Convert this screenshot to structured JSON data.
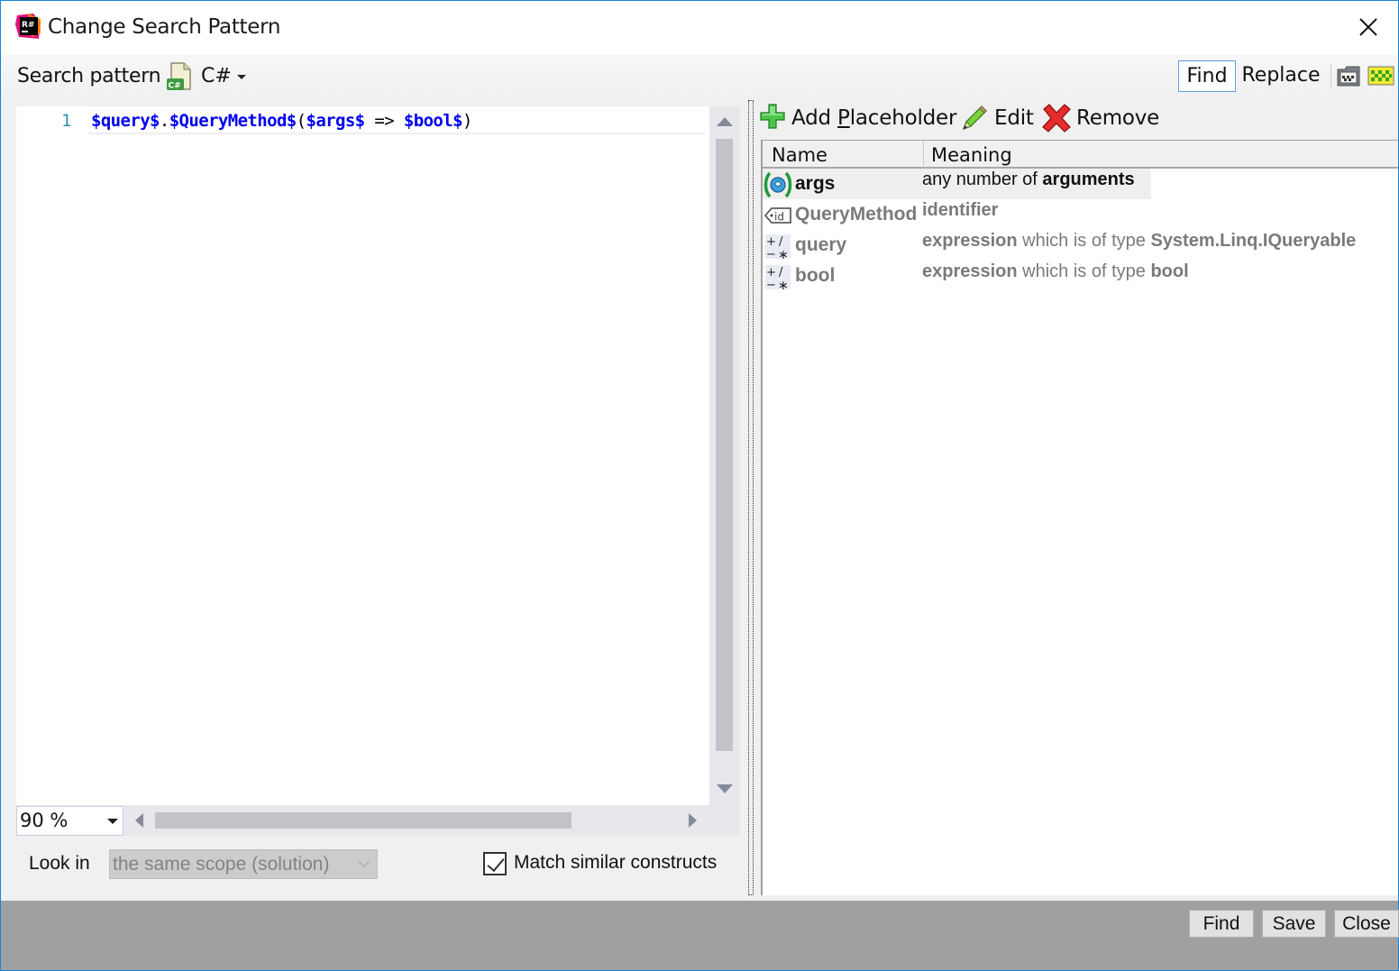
{
  "window": {
    "title": "Change Search Pattern",
    "close_icon": "close-x-icon",
    "accent_color": "#1883d7"
  },
  "toolbar": {
    "search_pattern_label": "Search pattern",
    "language": "C#",
    "language_icon": "csharp-file-icon",
    "mode_find": "Find",
    "mode_replace": "Replace",
    "active_mode": "Find"
  },
  "editor": {
    "line_number": "1",
    "code_tokens": [
      {
        "text": "$query$",
        "kind": "placeholder"
      },
      {
        "text": ".",
        "kind": "punct"
      },
      {
        "text": "$QueryMethod$",
        "kind": "placeholder"
      },
      {
        "text": "(",
        "kind": "punct"
      },
      {
        "text": "$args$",
        "kind": "placeholder"
      },
      {
        "text": " => ",
        "kind": "punct"
      },
      {
        "text": "$bool$",
        "kind": "placeholder"
      },
      {
        "text": ")",
        "kind": "punct"
      }
    ],
    "zoom": "90 %"
  },
  "options": {
    "look_in_label": "Look in",
    "look_in_value": "the same scope (solution)",
    "match_similar_label": "Match similar constructs",
    "match_similar_checked": true
  },
  "placeholders": {
    "add_label_prefix": "Add ",
    "add_label_mnemonic": "P",
    "add_label_suffix": "laceholder",
    "edit_label": "Edit",
    "remove_label": "Remove",
    "columns": {
      "name": "Name",
      "meaning": "Meaning"
    },
    "rows": [
      {
        "name": "args",
        "icon": "argument-placeholder-icon",
        "selected": true,
        "meaning": [
          {
            "t": "any number of ",
            "b": false
          },
          {
            "t": "arguments",
            "b": true
          }
        ]
      },
      {
        "name": "QueryMethod",
        "icon": "identifier-placeholder-icon",
        "selected": false,
        "meaning": [
          {
            "t": "identifier",
            "b": true
          }
        ]
      },
      {
        "name": "query",
        "icon": "expression-placeholder-icon",
        "selected": false,
        "meaning": [
          {
            "t": "expression",
            "b": true
          },
          {
            "t": " which is of type ",
            "b": false
          },
          {
            "t": "System.Linq.IQueryable",
            "b": true
          }
        ]
      },
      {
        "name": "bool",
        "icon": "expression-placeholder-icon",
        "selected": false,
        "meaning": [
          {
            "t": "expression",
            "b": true
          },
          {
            "t": " which is of type ",
            "b": false
          },
          {
            "t": "bool",
            "b": true
          }
        ]
      }
    ]
  },
  "footer": {
    "find_label": "Find",
    "save_label": "Save",
    "close_label": "Close"
  }
}
